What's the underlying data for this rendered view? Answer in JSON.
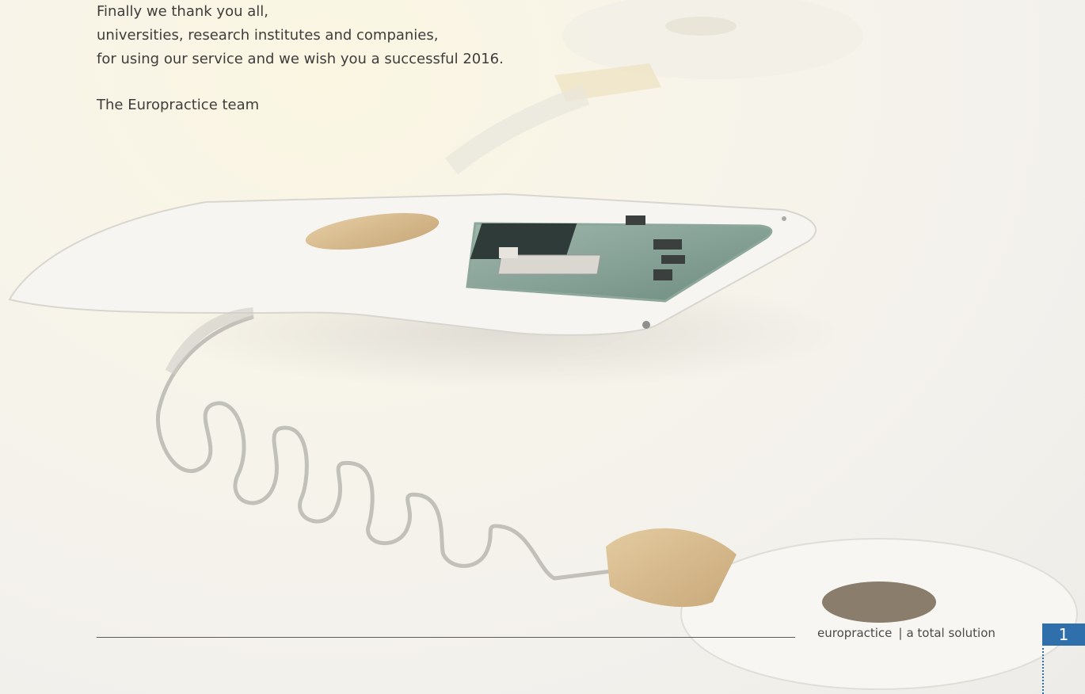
{
  "letter": {
    "lines": [
      "Finally we thank you all,",
      "universities, research institutes and companies,",
      "for using our service and we wish you a successful 2016."
    ],
    "signoff": "The Europractice team"
  },
  "footer": {
    "brand": "europractice",
    "separator": "|",
    "tagline": "a total solution",
    "page_number": "1"
  },
  "colors": {
    "accent": "#2f6fab",
    "text": "#3f3d3b"
  }
}
